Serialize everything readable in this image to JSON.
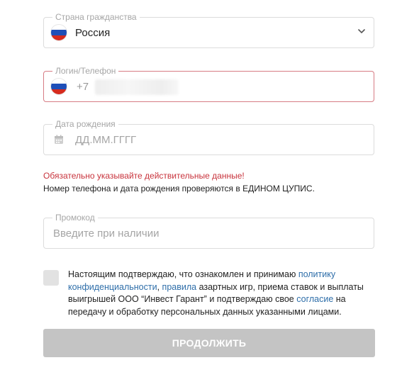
{
  "country_field": {
    "legend": "Страна гражданства",
    "value": "Россия",
    "flag_icon": "russia-flag-icon",
    "chevron_icon": "chevron-down-icon"
  },
  "login_field": {
    "legend": "Логин/Телефон",
    "prefix": "+7",
    "flag_icon": "russia-flag-icon",
    "value_obscured": true,
    "border_color": "#d77c84"
  },
  "birthdate_field": {
    "legend": "Дата рождения",
    "placeholder": "ДД.ММ.ГГГГ",
    "icon": "calendar-icon"
  },
  "notices": {
    "warning": "Обязательно указывайте действительные данные!",
    "warning_color": "#c8333c",
    "info": "Номер телефона и дата рождения проверяются в ЕДИНОМ ЦУПИС."
  },
  "promo_field": {
    "legend": "Промокод",
    "placeholder": "Введите при наличии"
  },
  "consent": {
    "checked": false,
    "text_1": "Настоящим подтверждаю, что ознакомлен и принимаю ",
    "link_policy": "политику конфиденциальности",
    "text_2": ", ",
    "link_rules": "правила",
    "text_3": " азартных игр, приема ставок и выплаты выигрышей ООО “Инвест Гарант” и подтверждаю свое ",
    "link_consent": "согласие",
    "text_4": " на передачу и обработку персональных данных указанными лицами.",
    "link_color": "#2e6ea9"
  },
  "submit": {
    "label": "ПРОДОЛЖИТЬ",
    "disabled": true,
    "background": "#c4c4c4"
  }
}
